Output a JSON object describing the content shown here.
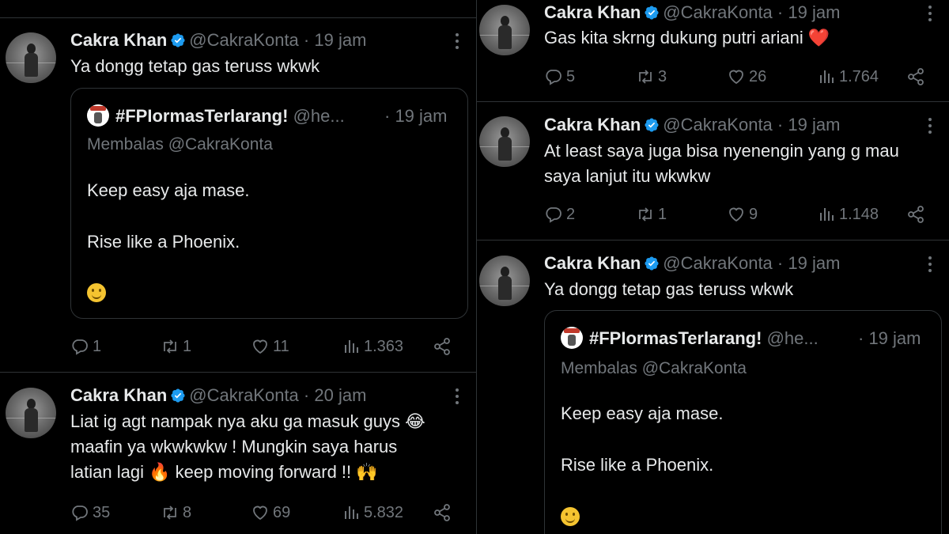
{
  "author": {
    "name": "Cakra Khan",
    "handle": "@CakraKonta",
    "dot": "·"
  },
  "quoted": {
    "name": "#FPIormasTerlarang!",
    "handle": "@he...",
    "time": "· 19 jam",
    "reply": "Membalas @CakraKonta",
    "line1": "Keep easy aja mase.",
    "line2": "Rise like a Phoenix."
  },
  "left": {
    "tweet1": {
      "time": "19 jam",
      "text": "Ya dongg tetap gas teruss wkwk",
      "replies": "1",
      "retweets": "1",
      "likes": "11",
      "views": "1.363"
    },
    "tweet2": {
      "time": "20 jam",
      "line1": "Liat ig agt nampak nya aku ga masuk guys",
      "line1_emoji": "😂",
      "line2": "maafin ya  wkwkwkw ! Mungkin saya harus",
      "line3": "latian lagi",
      "line3_emoji": "🔥",
      "line3b": "keep moving forward !!",
      "line3_emoji2": "🙌",
      "replies": "35",
      "retweets": "8",
      "likes": "69",
      "views": "5.832"
    }
  },
  "right": {
    "tweet1": {
      "time": "19 jam",
      "text": "Gas kita skrng dukung putri ariani",
      "emoji": "❤️",
      "replies": "5",
      "retweets": "3",
      "likes": "26",
      "views": "1.764"
    },
    "tweet2": {
      "time": "19 jam",
      "line1": "At least saya juga bisa nyenengin yang g mau",
      "line2": "saya lanjut itu wkwkw",
      "replies": "2",
      "retweets": "1",
      "likes": "9",
      "views": "1.148"
    },
    "tweet3": {
      "time": "19 jam",
      "text": "Ya dongg tetap gas teruss wkwk"
    }
  },
  "icons": {
    "verified": "verified-badge-icon",
    "reply": "reply-icon",
    "retweet": "retweet-icon",
    "like": "heart-icon",
    "views": "views-icon",
    "share": "share-icon",
    "more": "more-icon"
  },
  "colors": {
    "background": "#000000",
    "text": "#e7e9ea",
    "muted": "#71767b",
    "border": "#2f3336",
    "verified": "#1d9bf0"
  }
}
